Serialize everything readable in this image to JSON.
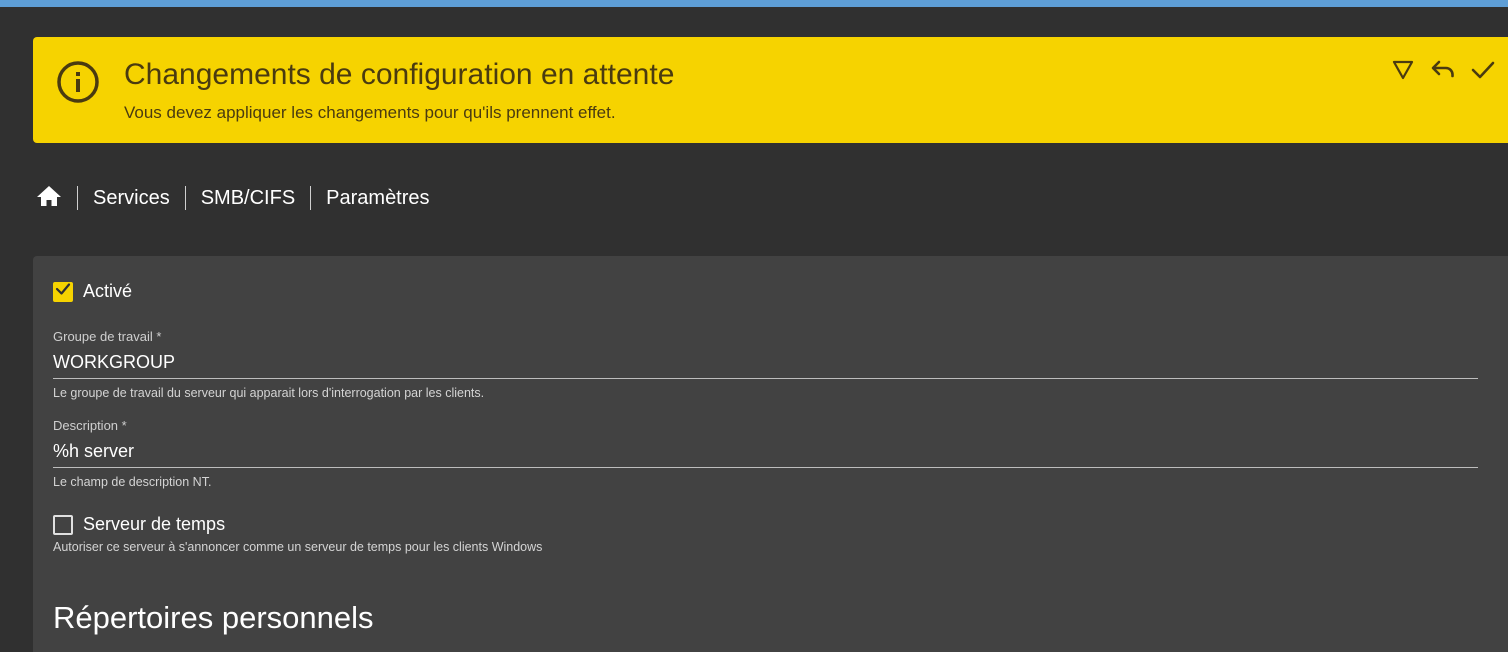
{
  "colors": {
    "topbar": "#5e9ed6",
    "banner_bg": "#f6d300",
    "banner_text": "#4a3b10",
    "page_bg": "#303030",
    "card_bg": "#424242",
    "checkbox_checked": "#f6d300"
  },
  "banner": {
    "icon": "info-circle-icon",
    "title": "Changements de configuration en attente",
    "subtitle": "Vous devez appliquer les changements pour qu'ils prennent effet.",
    "actions": [
      {
        "name": "show-details",
        "icon": "triangle-down-icon"
      },
      {
        "name": "undo",
        "icon": "undo-icon"
      },
      {
        "name": "apply",
        "icon": "check-icon"
      }
    ]
  },
  "breadcrumb": {
    "home_icon": "home-icon",
    "items": [
      "Services",
      "SMB/CIFS",
      "Paramètres"
    ]
  },
  "form": {
    "enabled": {
      "label": "Activé",
      "checked": true
    },
    "workgroup": {
      "label": "Groupe de travail *",
      "value": "WORKGROUP",
      "hint": "Le groupe de travail du serveur qui apparait lors d'interrogation par les clients."
    },
    "description": {
      "label": "Description *",
      "value": "%h server",
      "hint": "Le champ de description NT."
    },
    "time_server": {
      "label": "Serveur de temps",
      "checked": false,
      "hint": "Autoriser ce serveur à s'annoncer comme un serveur de temps pour les clients Windows"
    },
    "section_home_dirs": "Répertoires personnels"
  }
}
